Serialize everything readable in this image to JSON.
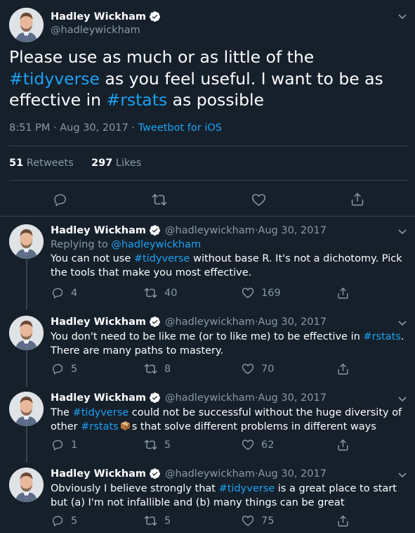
{
  "main_tweet": {
    "name": "Hadley Wickham",
    "handle": "@hadleywickham",
    "text_parts": [
      "Please use as much or as little of the ",
      "#tidyverse",
      " as you feel useful. I want to be as effective in ",
      "#rstats",
      " as possible"
    ],
    "time": "8:51 PM",
    "date": "Aug 30, 2017",
    "source": "Tweetbot for iOS",
    "retweets": "51",
    "retweets_label": "Retweets",
    "likes": "297",
    "likes_label": "Likes"
  },
  "replies": [
    {
      "name": "Hadley Wickham",
      "handle": "@hadleywickham",
      "date": "Aug 30, 2017",
      "replying_label": "Replying to",
      "replying_to": "@hadleywickham",
      "text_parts": [
        "You can not use ",
        "#tidyverse",
        " without base R. It's not a dichotomy. Pick the tools that make you most effective."
      ],
      "replies": "4",
      "retweets": "40",
      "likes": "169"
    },
    {
      "name": "Hadley Wickham",
      "handle": "@hadleywickham",
      "date": "Aug 30, 2017",
      "text_parts": [
        "You don't need to be like me (or to like me) to be effective in ",
        "#rstats",
        ". There are many paths to mastery."
      ],
      "replies": "5",
      "retweets": "8",
      "likes": "70"
    },
    {
      "name": "Hadley Wickham",
      "handle": "@hadleywickham",
      "date": "Aug 30, 2017",
      "text_parts": [
        "The ",
        "#tidyverse",
        " could not be successful without the huge diversity of other ",
        "#rstats",
        "s that solve different problems in different ways"
      ],
      "emoji": "package-emoji",
      "replies": "1",
      "retweets": "5",
      "likes": "62"
    },
    {
      "name": "Hadley Wickham",
      "handle": "@hadleywickham",
      "date": "Aug 30, 2017",
      "text_parts": [
        "Obviously I believe strongly that ",
        "#tidyverse",
        " is a great place to start but (a) I'm not infallible and (b) many things can be great"
      ],
      "replies": "5",
      "retweets": "5",
      "likes": "75"
    }
  ],
  "separator": " · ",
  "colors": {
    "background": "#15202b",
    "accent": "#1da1f2",
    "muted": "#8899a6",
    "divider": "#38444d"
  },
  "icons": [
    "verified-icon",
    "chevron-down-icon",
    "reply-icon",
    "retweet-icon",
    "like-icon",
    "share-icon",
    "package-emoji"
  ]
}
